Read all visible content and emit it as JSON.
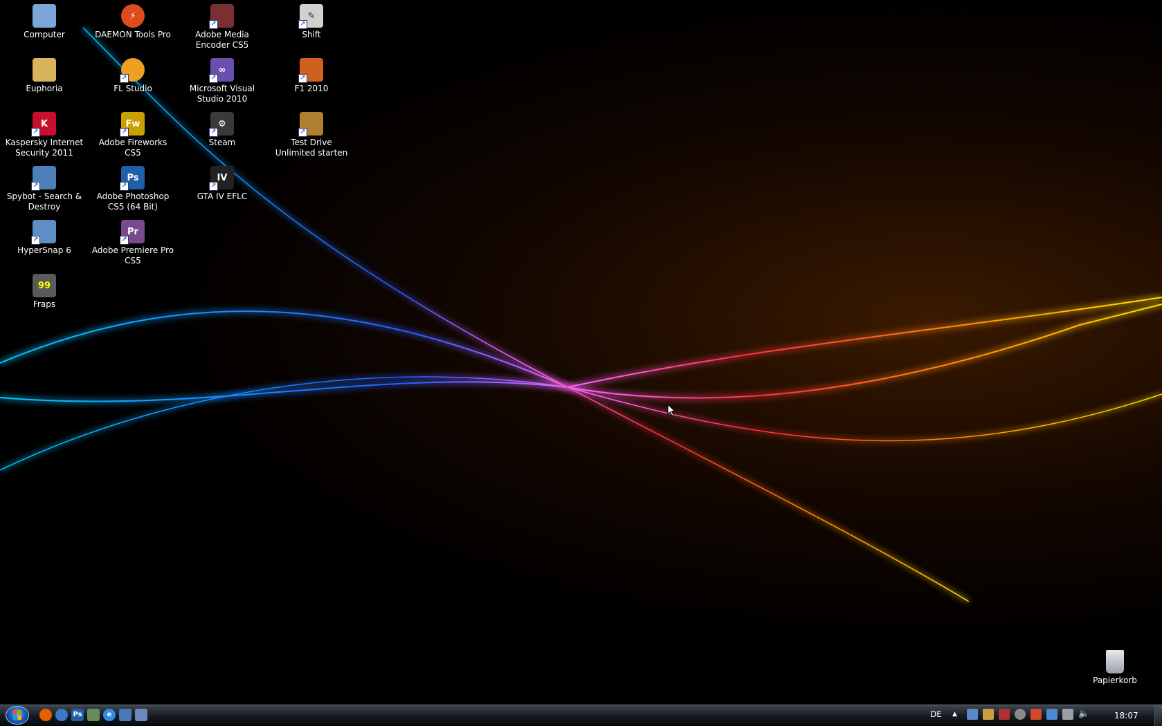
{
  "desktop": {
    "icons": [
      {
        "label": "Computer",
        "icon": "computer-icon",
        "color": "#7aa6d8"
      },
      {
        "label": "Euphoria",
        "icon": "folder-icon",
        "color": "#d9b35c"
      },
      {
        "label": "Kaspersky Internet Security 2011",
        "icon": "kaspersky-icon",
        "color": "#c8102e"
      },
      {
        "label": "Spybot - Search & Destroy",
        "icon": "spybot-icon",
        "color": "#4d7fb8"
      },
      {
        "label": "HyperSnap 6",
        "icon": "hypersnap-icon",
        "color": "#5c8fc6"
      },
      {
        "label": "Fraps",
        "icon": "fraps-icon",
        "color": "#5a5a5a"
      },
      {
        "label": "DAEMON Tools Pro",
        "icon": "daemon-tools-icon",
        "color": "#e04a1f"
      },
      {
        "label": "FL Studio",
        "icon": "fl-studio-icon",
        "color": "#f0a020"
      },
      {
        "label": "Adobe Fireworks CS5",
        "icon": "fireworks-icon",
        "color": "#c9a000",
        "glyph": "Fw"
      },
      {
        "label": "Adobe Photoshop CS5 (64 Bit)",
        "icon": "photoshop-icon",
        "color": "#1f5fa8",
        "glyph": "Ps"
      },
      {
        "label": "Adobe Premiere Pro CS5",
        "icon": "premiere-icon",
        "color": "#7b4a8e",
        "glyph": "Pr"
      },
      {
        "label": "Adobe Media Encoder CS5",
        "icon": "media-encoder-icon",
        "color": "#7a3030"
      },
      {
        "label": "Microsoft Visual Studio 2010",
        "icon": "visual-studio-icon",
        "color": "#6a4fb0"
      },
      {
        "label": "Steam",
        "icon": "steam-icon",
        "color": "#3a3a3a"
      },
      {
        "label": "GTA IV EFLC",
        "icon": "gta-icon",
        "color": "#222222",
        "glyph": "IV"
      },
      {
        "label": "Shift",
        "icon": "shift-icon",
        "color": "#d0d0d0"
      },
      {
        "label": "F1 2010",
        "icon": "f1-icon",
        "color": "#d06020"
      },
      {
        "label": "Test Drive Unlimited starten",
        "icon": "test-drive-icon",
        "color": "#b08030"
      }
    ],
    "recycle_bin": {
      "label": "Papierkorb",
      "icon": "recycle-bin-icon"
    }
  },
  "taskbar": {
    "quick_launch": [
      {
        "icon": "firefox-icon",
        "color": "#e66000"
      },
      {
        "icon": "chrome-like-icon",
        "color": "#3d78c8"
      },
      {
        "icon": "photoshop-small-icon",
        "color": "#1f5fa8",
        "glyph": "Ps"
      },
      {
        "icon": "monitor-icon",
        "color": "#6a8a5a"
      },
      {
        "icon": "internet-explorer-icon",
        "color": "#2f8de4",
        "glyph": "e"
      },
      {
        "icon": "desktop-icon",
        "color": "#4a78b8"
      },
      {
        "icon": "window-switch-icon",
        "color": "#6a8ac0"
      }
    ],
    "language": "DE",
    "tray_icons": [
      {
        "icon": "users-tray-icon",
        "color": "#5a88c8"
      },
      {
        "icon": "daemon-tray-icon",
        "color": "#c8a040"
      },
      {
        "icon": "kaspersky-tray-icon",
        "color": "#b03030"
      },
      {
        "icon": "steam-tray-icon",
        "color": "#8a8a8a"
      },
      {
        "icon": "security-tray-icon",
        "color": "#d04a2a"
      },
      {
        "icon": "update-tray-icon",
        "color": "#4a8ad0"
      },
      {
        "icon": "network-tray-icon",
        "color": "#9aa0a8"
      },
      {
        "icon": "volume-tray-icon",
        "color": "#c0c4c8"
      }
    ],
    "clock": "18:07"
  }
}
